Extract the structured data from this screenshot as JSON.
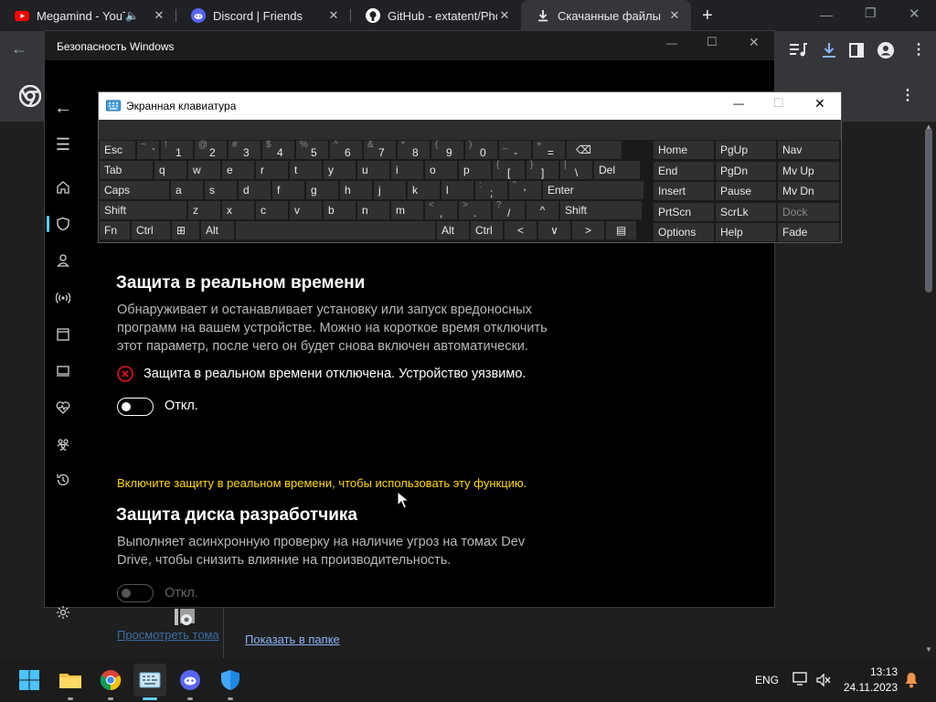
{
  "colors": {
    "accent": "#60cdff",
    "warning": "#ffd700",
    "error": "#e81123",
    "link": "#8ab4f8"
  },
  "tabs": [
    {
      "label": "Megamind - YouT",
      "icon": "youtube-icon",
      "extra": "audio-icon"
    },
    {
      "label": "Discord | Friends",
      "icon": "discord-icon"
    },
    {
      "label": "GitHub - extatent/Pho",
      "icon": "github-icon"
    },
    {
      "label": "Скачанные файлы",
      "icon": "download-icon",
      "active": true
    }
  ],
  "downloads": {
    "show_in_folder": "Показать в папке"
  },
  "security": {
    "window_title": "Безопасность Windows",
    "rt_title": "Защита в реальном времени",
    "rt_desc": [
      "Обнаруживает и останавливает установку или запуск вредоносных",
      "программ на вашем устройстве. Можно на короткое время отключить",
      "этот параметр, после чего он будет снова включен автоматически."
    ],
    "rt_status": "Защита в реальном времени отключена. Устройство уязвимо.",
    "rt_toggle": "Откл.",
    "notice": "Включите защиту в реальном времени, чтобы использовать эту функцию.",
    "dev_title": "Защита диска разработчика",
    "dev_desc": [
      "Выполняет асинхронную проверку на наличие угроз на томах Dev",
      "Drive, чтобы снизить влияние на производительность."
    ],
    "dev_toggle": "Откл.",
    "view_volumes": "Просмотреть тома"
  },
  "osk": {
    "title": "Экранная клавиатура",
    "rows": [
      [
        [
          "Esc",
          ""
        ],
        [
          "`",
          "~"
        ],
        [
          "1",
          "!"
        ],
        [
          "2",
          "@"
        ],
        [
          "3",
          "#"
        ],
        [
          "4",
          "$"
        ],
        [
          "5",
          "%"
        ],
        [
          "6",
          "^"
        ],
        [
          "7",
          "&"
        ],
        [
          "8",
          "*"
        ],
        [
          "9",
          "("
        ],
        [
          "0",
          ")"
        ],
        [
          "-",
          "_"
        ],
        [
          "=",
          "+"
        ],
        [
          "⌫",
          ""
        ]
      ],
      [
        [
          "Tab",
          ""
        ],
        [
          "q",
          ""
        ],
        [
          "w",
          ""
        ],
        [
          "e",
          ""
        ],
        [
          "r",
          ""
        ],
        [
          "t",
          ""
        ],
        [
          "y",
          ""
        ],
        [
          "u",
          ""
        ],
        [
          "i",
          ""
        ],
        [
          "o",
          ""
        ],
        [
          "p",
          ""
        ],
        [
          "[",
          "{"
        ],
        [
          "]",
          "}"
        ],
        [
          "\\",
          "|"
        ],
        [
          "Del",
          ""
        ]
      ],
      [
        [
          "Caps",
          ""
        ],
        [
          "a",
          ""
        ],
        [
          "s",
          ""
        ],
        [
          "d",
          ""
        ],
        [
          "f",
          ""
        ],
        [
          "g",
          ""
        ],
        [
          "h",
          ""
        ],
        [
          "j",
          ""
        ],
        [
          "k",
          ""
        ],
        [
          "l",
          ""
        ],
        [
          ";",
          ":"
        ],
        [
          "'",
          "\""
        ],
        [
          "Enter",
          ""
        ]
      ],
      [
        [
          "Shift",
          ""
        ],
        [
          "z",
          ""
        ],
        [
          "x",
          ""
        ],
        [
          "c",
          ""
        ],
        [
          "v",
          ""
        ],
        [
          "b",
          ""
        ],
        [
          "n",
          ""
        ],
        [
          "m",
          ""
        ],
        [
          ",",
          "<"
        ],
        [
          ".",
          ">"
        ],
        [
          "/",
          "?"
        ],
        [
          "^",
          ""
        ],
        [
          "Shift",
          ""
        ]
      ],
      [
        [
          "Fn",
          ""
        ],
        [
          "Ctrl",
          ""
        ],
        [
          "⊞",
          ""
        ],
        [
          "Alt",
          ""
        ],
        [
          "",
          ""
        ],
        [
          "Alt",
          ""
        ],
        [
          "Ctrl",
          ""
        ],
        [
          "<",
          ""
        ],
        [
          "∨",
          ""
        ],
        [
          ">",
          ""
        ],
        [
          "▤",
          ""
        ]
      ]
    ],
    "nav": [
      [
        "Home",
        "PgUp",
        "Nav"
      ],
      [
        "End",
        "PgDn",
        "Mv Up"
      ],
      [
        "Insert",
        "Pause",
        "Mv Dn"
      ],
      [
        "PrtScn",
        "ScrLk",
        "Dock"
      ],
      [
        "Options",
        "Help",
        "Fade"
      ]
    ]
  },
  "tray": {
    "lang": "ENG",
    "time": "13:13",
    "date": "24.11.2023"
  }
}
